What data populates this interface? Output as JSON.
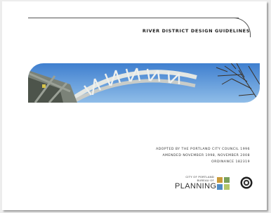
{
  "document": {
    "title": "RIVER DISTRICT DESIGN GUIDELINES",
    "adoption": {
      "line1": "ADOPTED BY THE PORTLAND CITY COUNCIL 1996",
      "line2": "AMENDED NOVEMBER 1998, NOVEMBER 2008",
      "line3": "ORDINANCE 182319"
    }
  },
  "logo": {
    "line1": "CITY OF PORTLAND",
    "line2": "BUREAU OF",
    "line3": "PLANNING",
    "square_colors": [
      "#c99a3a",
      "#7aa05a",
      "#4f8bc4",
      "#b5c76a"
    ],
    "seal": "city-seal"
  },
  "banner": {
    "image": "bridge-truss-photo",
    "colors": {
      "sky": "#4f8fd6",
      "steel": "#d8dcd8"
    }
  }
}
